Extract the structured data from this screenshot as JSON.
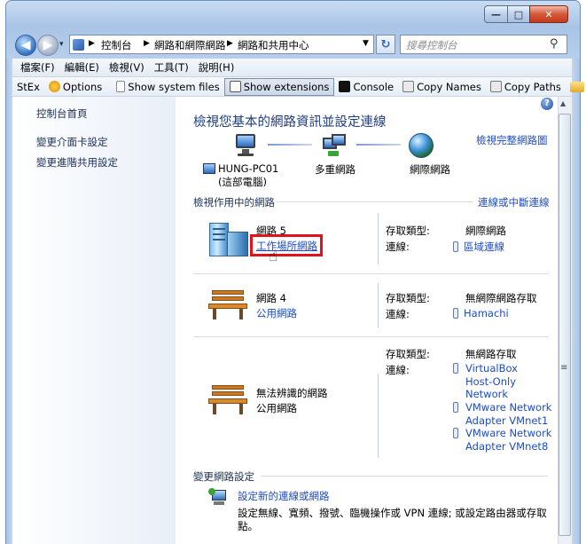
{
  "window": {
    "minimize_glyph": "—",
    "maximize_glyph": "□",
    "close_glyph": "✕"
  },
  "nav": {
    "back_glyph": "◀",
    "forward_glyph": "▶",
    "breadcrumb": [
      "控制台",
      "網路和網際網路",
      "網路和共用中心"
    ],
    "refresh_glyph": "↻",
    "search_placeholder": "搜尋控制台"
  },
  "menu": [
    "檔案(F)",
    "編輯(E)",
    "檢視(V)",
    "工具(T)",
    "說明(H)"
  ],
  "toolbar": {
    "stex": "StEx",
    "options": "Options",
    "show_system_files": "Show system files",
    "show_extensions": "Show extensions",
    "console": "Console",
    "copy_names": "Copy Names",
    "copy_paths": "Copy Paths",
    "overflow": "»"
  },
  "sidebar": {
    "home": "控制台首頁",
    "items": [
      "變更介面卡設定",
      "變更進階共用設定"
    ]
  },
  "main": {
    "help": "?",
    "title": "檢視您基本的網路資訊並設定連線",
    "full_map_link": "檢視完整網路圖",
    "map": {
      "computer_name": "HUNG-PC01",
      "computer_sub": "(這部電腦)",
      "middle": "多重網路",
      "internet": "網際網路"
    },
    "active_header": "檢視作用中的網路",
    "connect_link": "連線或中斷連線",
    "access_label": "存取類型:",
    "conn_label": "連線:",
    "networks": [
      {
        "name": "網路  5",
        "type": "工作場所網路",
        "access": "網際網路",
        "connections": [
          "區域連線"
        ]
      },
      {
        "name": "網路  4",
        "type": "公用網路",
        "access": "無網際網路存取",
        "connections": [
          "Hamachi"
        ]
      },
      {
        "name": "無法辨識的網路",
        "type": "公用網路",
        "access": "無網路存取",
        "connections": [
          [
            "VirtualBox",
            "Host-Only",
            "Network"
          ],
          [
            "VMware Network",
            "Adapter VMnet1"
          ],
          [
            "VMware Network",
            "Adapter VMnet8"
          ]
        ]
      }
    ],
    "change_header": "變更網路設定",
    "setup_link": "設定新的連線或網路",
    "setup_desc_line1": "設定無線、寬頻、撥號、臨機操作或 VPN 連線; 或設定路由器或存取",
    "setup_desc_line2": "點。"
  },
  "scrollbar": {
    "grip": "≡"
  },
  "colors": {
    "highlight_box": "#e0121c",
    "link": "#1e4cc4",
    "title": "#1e3d80"
  }
}
